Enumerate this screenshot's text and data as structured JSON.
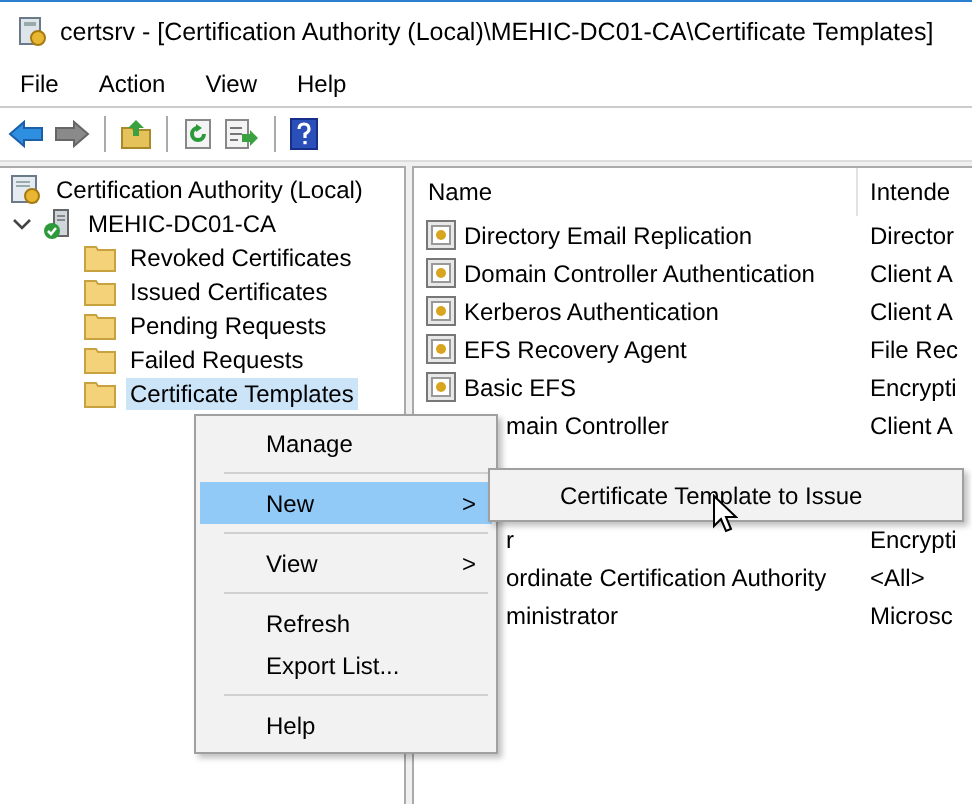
{
  "window": {
    "title": "certsrv - [Certification Authority (Local)\\MEHIC-DC01-CA\\Certificate Templates]"
  },
  "menu_bar": [
    "File",
    "Action",
    "View",
    "Help"
  ],
  "tree": {
    "label": "Certification Authority (Local)",
    "children": [
      {
        "label": "MEHIC-DC01-CA",
        "expanded": true,
        "children": [
          {
            "label": "Revoked Certificates",
            "selected": false
          },
          {
            "label": "Issued Certificates",
            "selected": false
          },
          {
            "label": "Pending Requests",
            "selected": false
          },
          {
            "label": "Failed Requests",
            "selected": false
          },
          {
            "label": "Certificate Templates",
            "selected": true
          }
        ]
      }
    ]
  },
  "list": {
    "columns": [
      "Name",
      "Intende"
    ],
    "rows": [
      {
        "kind": "full",
        "name": "Directory Email Replication",
        "purpose": "Director"
      },
      {
        "kind": "full",
        "name": "Domain Controller Authentication",
        "purpose": "Client A"
      },
      {
        "kind": "full",
        "name": "Kerberos Authentication",
        "purpose": "Client A"
      },
      {
        "kind": "full",
        "name": "EFS Recovery Agent",
        "purpose": "File Rec"
      },
      {
        "kind": "full",
        "name": "Basic EFS",
        "purpose": "Encrypti"
      },
      {
        "kind": "clipped",
        "name": "main Controller",
        "purpose": "Client A"
      }
    ],
    "rows_below": [
      {
        "kind": "clipped",
        "name": "r",
        "purpose": "Encrypti"
      },
      {
        "kind": "clipped",
        "name": "ordinate Certification Authority",
        "purpose": "<All>"
      },
      {
        "kind": "clipped",
        "name": "ministrator",
        "purpose": "Microsc"
      }
    ]
  },
  "context_menu": [
    {
      "kind": "item",
      "label": "Manage",
      "selected": false
    },
    {
      "kind": "separator"
    },
    {
      "kind": "item",
      "label": "New",
      "selected": true,
      "arrow": ">"
    },
    {
      "kind": "separator"
    },
    {
      "kind": "item",
      "label": "View",
      "selected": false,
      "arrow": ">"
    },
    {
      "kind": "separator"
    },
    {
      "kind": "item",
      "label": "Refresh",
      "selected": false
    },
    {
      "kind": "item",
      "label": "Export List...",
      "selected": false
    },
    {
      "kind": "separator"
    },
    {
      "kind": "item",
      "label": "Help",
      "selected": false
    }
  ],
  "submenu": [
    {
      "label": "Certificate Template to Issue",
      "selected": false
    }
  ]
}
